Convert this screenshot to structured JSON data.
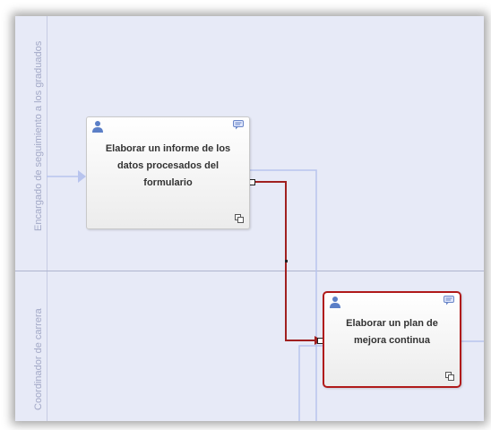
{
  "lanes": [
    {
      "label": "Encargado de seguimiento a los graduados"
    },
    {
      "label": "Coordinador de carrera"
    }
  ],
  "tasks": [
    {
      "label": "Elaborar un informe de los datos procesados del formulario"
    },
    {
      "label": "Elaborar un plan de mejora continua",
      "selected": true
    }
  ],
  "colors": {
    "lane_bg": "#e7eaf7",
    "connector": "#a02020",
    "flow": "#b8c4ee",
    "selection": "#b01a1a"
  }
}
